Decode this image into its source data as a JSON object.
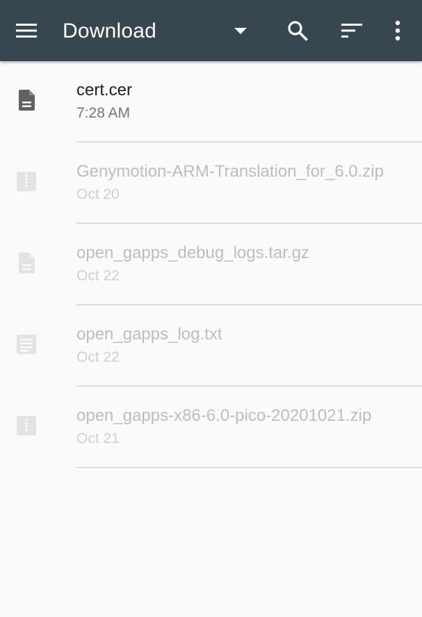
{
  "toolbar": {
    "title": "Download",
    "background": "#37474f",
    "icons": [
      "menu-icon",
      "dropdown-arrow-icon",
      "search-icon",
      "sort-icon",
      "more-vert-icon"
    ]
  },
  "files": [
    {
      "name": "cert.cer",
      "date": "7:28 AM",
      "icon": "document-icon",
      "enabled": true
    },
    {
      "name": "Genymotion-ARM-Translation_for_6.0.zip",
      "date": "Oct 20",
      "icon": "zip-icon",
      "enabled": false
    },
    {
      "name": "open_gapps_debug_logs.tar.gz",
      "date": "Oct 22",
      "icon": "document-icon",
      "enabled": false
    },
    {
      "name": "open_gapps_log.txt",
      "date": "Oct 22",
      "icon": "text-file-icon",
      "enabled": false
    },
    {
      "name": "open_gapps-x86-6.0-pico-20201021.zip",
      "date": "Oct 21",
      "icon": "zip-icon",
      "enabled": false
    }
  ]
}
